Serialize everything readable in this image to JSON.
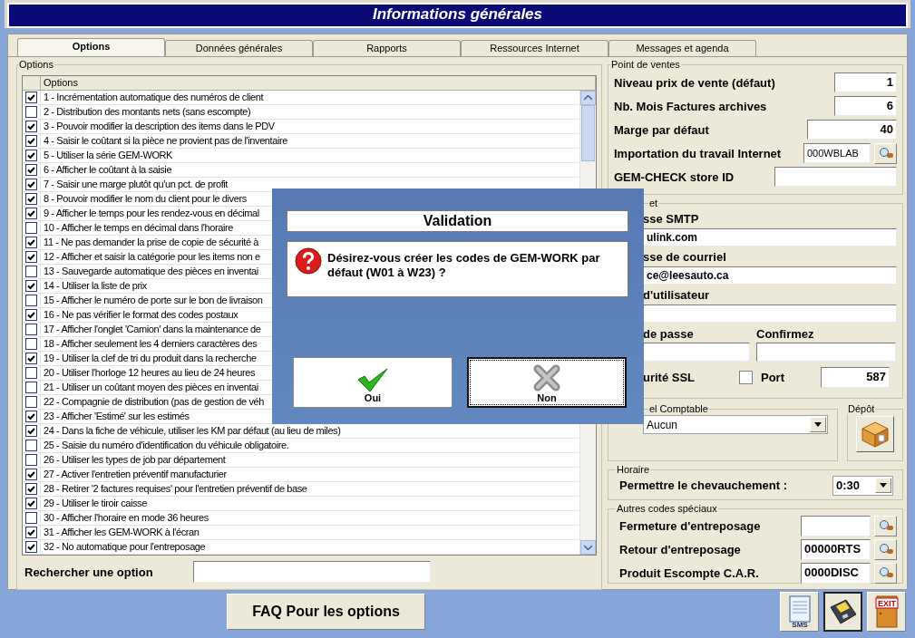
{
  "window": {
    "title": "Informations générales"
  },
  "tabs": [
    {
      "label": "Options",
      "selected": true
    },
    {
      "label": "Données générales",
      "selected": false
    },
    {
      "label": "Rapports",
      "selected": false
    },
    {
      "label": "Ressources Internet",
      "selected": false
    },
    {
      "label": "Messages et agenda",
      "selected": false
    }
  ],
  "options_group": {
    "title": "Options",
    "column_header": "Options",
    "search_label": "Rechercher une option",
    "rows": [
      {
        "label": "1 - Incrémentation automatique des numéros de client",
        "checked": true
      },
      {
        "label": "2 - Distribution des montants nets (sans escompte)",
        "checked": false
      },
      {
        "label": "3 - Pouvoir modifier la description des items dans le PDV",
        "checked": true
      },
      {
        "label": "4 - Saisir le coûtant si la pièce ne provient pas de l'inventaire",
        "checked": true
      },
      {
        "label": "5 - Utiliser la série GEM-WORK",
        "checked": true
      },
      {
        "label": "6 - Afficher le coûtant à la saisie",
        "checked": true
      },
      {
        "label": "7 - Saisir une marge plutôt qu'un pct. de profit",
        "checked": true
      },
      {
        "label": "8 - Pouvoir modifier le nom du client pour le divers",
        "checked": true
      },
      {
        "label": "9 - Afficher le temps pour les rendez-vous en décimal",
        "checked": true
      },
      {
        "label": "10 - Afficher le temps en décimal dans l'horaire",
        "checked": false
      },
      {
        "label": "11 - Ne pas demander la prise de copie de sécurité à",
        "checked": true
      },
      {
        "label": "12 - Afficher et saisir la catégorie pour les items non e",
        "checked": true
      },
      {
        "label": "13 - Sauvegarde automatique des pièces en inventai",
        "checked": false
      },
      {
        "label": "14 - Utiliser la liste de prix",
        "checked": true
      },
      {
        "label": "15 - Afficher le numéro de porte sur le bon de livraison",
        "checked": false
      },
      {
        "label": "16 - Ne pas vérifier le format des codes postaux",
        "checked": true
      },
      {
        "label": "17 - Afficher l'onglet 'Camion' dans la maintenance de",
        "checked": false
      },
      {
        "label": "18 - Afficher seulement les 4 derniers caractères des",
        "checked": false
      },
      {
        "label": "19 - Utiliser la clef de tri du produit dans la recherche",
        "checked": true
      },
      {
        "label": "20 - Utiliser l'horloge 12 heures au lieu de 24 heures",
        "checked": false
      },
      {
        "label": "21 - Utiliser un coûtant moyen des pièces en inventai",
        "checked": false
      },
      {
        "label": "22 - Compagnie de distribution (pas de gestion de véh",
        "checked": false
      },
      {
        "label": "23 - Afficher 'Estimé' sur les estimés",
        "checked": true
      },
      {
        "label": "24 - Dans la fiche de véhicule, utiliser les KM par défaut (au lieu de miles)",
        "checked": true
      },
      {
        "label": "25 - Saisie du numéro d'identification du véhicule obligatoire.",
        "checked": false
      },
      {
        "label": "26 - Utiliser les types de job par département",
        "checked": false
      },
      {
        "label": "27 - Activer l'entretien préventif manufacturier",
        "checked": true
      },
      {
        "label": "28 - Retirer '2 factures requises' pour l'entretien préventif de base",
        "checked": true
      },
      {
        "label": "29 - Utiliser le tiroir caisse",
        "checked": true
      },
      {
        "label": "30 - Afficher l'horaire en mode 36 heures",
        "checked": false
      },
      {
        "label": "31 - Afficher les GEM-WORK à l'écran",
        "checked": true
      },
      {
        "label": "32 - No automatique pour l'entreposage",
        "checked": true
      }
    ]
  },
  "point_de_ventes": {
    "title": "Point de ventes",
    "fields": [
      {
        "label": "Niveau prix de vente (défaut)",
        "value": "1",
        "kind": "short"
      },
      {
        "label": "Nb. Mois Factures archives",
        "value": "6",
        "kind": "short"
      },
      {
        "label": "Marge par défaut",
        "value": "40",
        "kind": "medium"
      },
      {
        "label": "Importation du travail Internet",
        "value": "000WBLAB",
        "kind": "lookup"
      },
      {
        "label": "GEM-CHECK store ID",
        "kind": "wide"
      }
    ]
  },
  "internet": {
    "title": "et",
    "smtp_label": "sse SMTP",
    "smtp_value": "ulink.com",
    "email_label": "sse de courriel",
    "email_value": "ce@leesauto.ca",
    "user_label": "d'utilisateur",
    "password_label": "de passe",
    "confirm_label": "Confirmez",
    "ssl_label": "urité  SSL",
    "ssl_checked": false,
    "port_label": "Port",
    "port_value": "587"
  },
  "accounting": {
    "title": "el Comptable",
    "value": "Aucun"
  },
  "depot": {
    "title": "Dépôt"
  },
  "horaire": {
    "title": "Horaire",
    "label": "Permettre le chevauchement :",
    "value": "0:30"
  },
  "autres_codes": {
    "title": "Autres codes spéciaux",
    "rows": [
      {
        "label": "Fermeture d'entreposage"
      },
      {
        "label": "Retour d'entreposage",
        "value": "00000RTS"
      },
      {
        "label": "Produit Escompte C.A.R.",
        "value": "0000DISC"
      }
    ]
  },
  "faq_button": "FAQ Pour les options",
  "toolbar": [
    {
      "kind": "sms",
      "label": "SMS"
    },
    {
      "kind": "save"
    },
    {
      "kind": "exit",
      "label": "EXIT"
    }
  ],
  "dialog": {
    "title": "Validation",
    "message": "Désirez-vous créer les codes de GEM-WORK par défaut (W01 à W23) ?",
    "buttons": [
      {
        "kind": "yes",
        "label": "Oui",
        "focused": false
      },
      {
        "kind": "no",
        "label": "Non",
        "focused": true
      }
    ]
  }
}
